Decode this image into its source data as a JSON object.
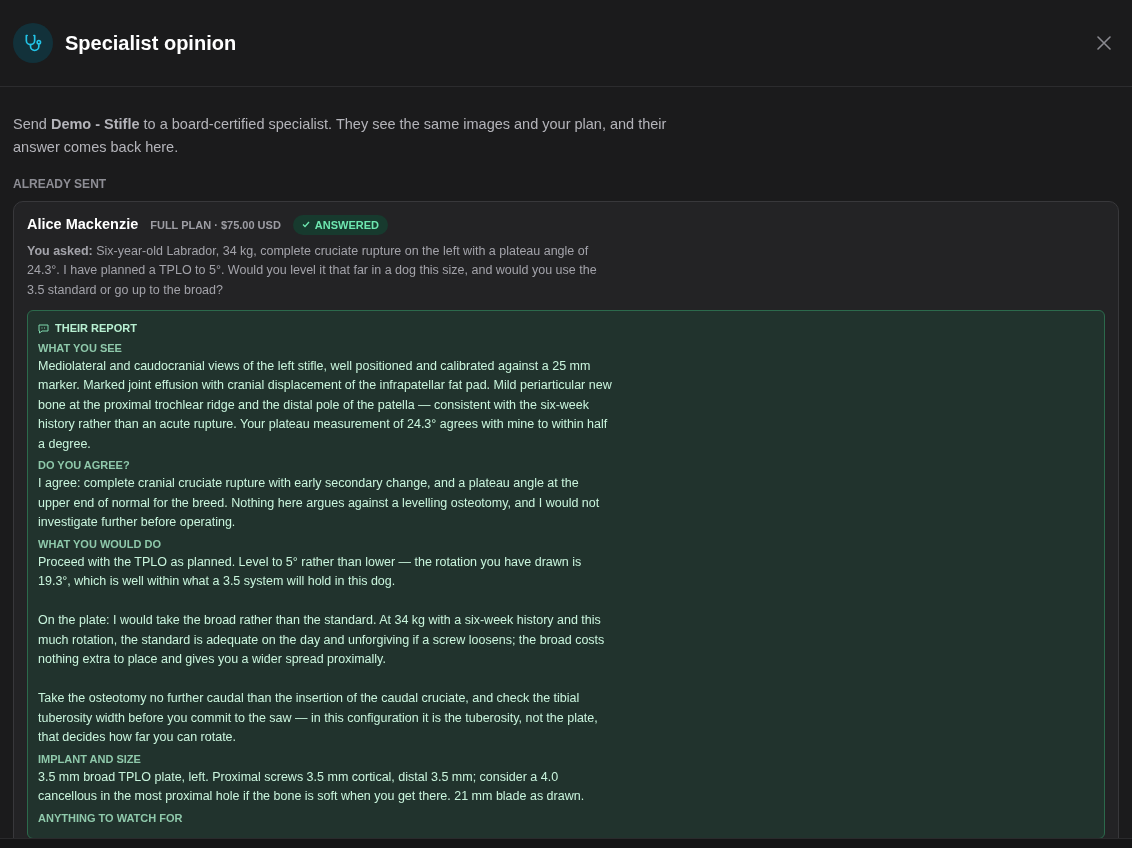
{
  "header": {
    "title": "Specialist opinion"
  },
  "intro": "Send **Demo - Stifle** to a board-certified specialist. They see the same images and your plan, and their answer comes back here.",
  "section_label": "ALREADY SENT",
  "requests": [
    {
      "specialist": "Alice Mackenzie",
      "plan": "FULL PLAN · $75.00 USD",
      "status": {
        "label": "ANSWERED",
        "answered": true
      },
      "question": "**You asked:** Six-year-old Labrador, 34 kg, complete cruciate rupture on the left with a plateau angle of 24.3°. I have planned a TPLO to 5°. Would you level it that far in a dog this size, and would you use the 3.5 standard or go up to the broad?",
      "report": {
        "title": "THEIR REPORT",
        "sections": [
          {
            "heading": "WHAT YOU SEE",
            "paragraphs": [
              "Mediolateral and caudocranial views of the left stifle, well positioned and calibrated against a 25 mm marker. Marked joint effusion with cranial displacement of the infrapatellar fat pad. Mild periarticular new bone at the proximal trochlear ridge and the distal pole of the patella — consistent with the six-week history rather than an acute rupture. Your plateau measurement of 24.3° agrees with mine to within half a degree."
            ]
          },
          {
            "heading": "DO YOU AGREE?",
            "paragraphs": [
              "I agree: complete cranial cruciate rupture with early secondary change, and a plateau angle at the upper end of normal for the breed. Nothing here argues against a levelling osteotomy, and I would not investigate further before operating."
            ]
          },
          {
            "heading": "WHAT YOU WOULD DO",
            "paragraphs": [
              "Proceed with the TPLO as planned. Level to 5° rather than lower — the rotation you have drawn is 19.3°, which is well within what a 3.5 system will hold in this dog.",
              "On the plate: I would take the broad rather than the standard. At 34 kg with a six-week history and this much rotation, the standard is adequate on the day and unforgiving if a screw loosens; the broad costs nothing extra to place and gives you a wider spread proximally.",
              "Take the osteotomy no further caudal than the insertion of the caudal cruciate, and check the tibial tuberosity width before you commit to the saw — in this configuration it is the tuberosity, not the plate, that decides how far you can rotate."
            ]
          },
          {
            "heading": "IMPLANT AND SIZE",
            "paragraphs": [
              "3.5 mm broad TPLO plate, left. Proximal screws 3.5 mm cortical, distal 3.5 mm; consider a 4.0 cancellous in the most proximal hole if the bone is soft when you get there. 21 mm blade as drawn."
            ]
          },
          {
            "heading": "ANYTHING TO WATCH FOR"
          }
        ]
      }
    }
  ]
}
